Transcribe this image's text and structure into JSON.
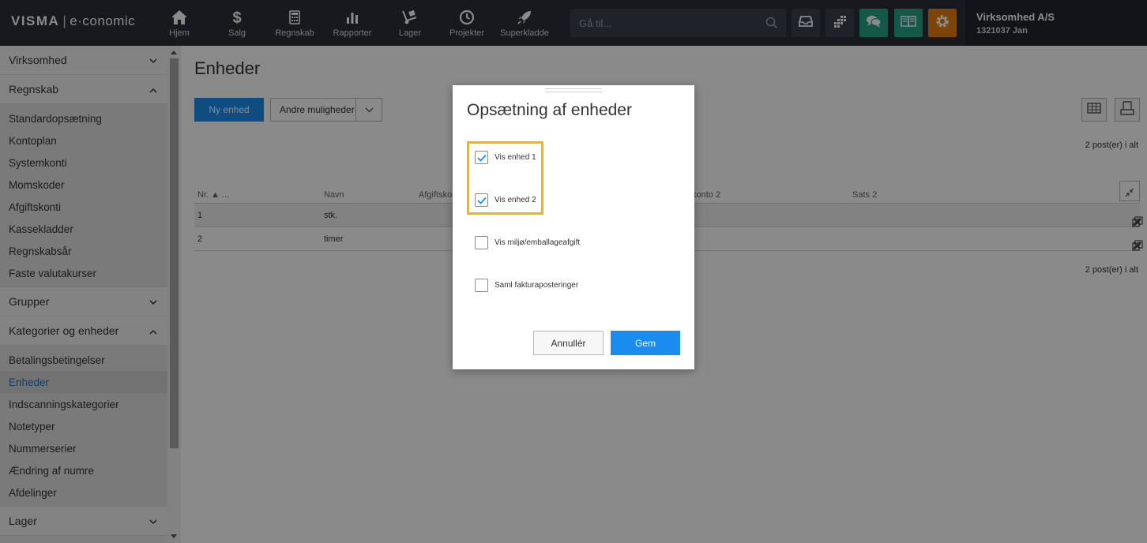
{
  "topbar": {
    "logo": {
      "brand": "VISMA",
      "sep": "|",
      "product": "e·conomic"
    },
    "nav": [
      {
        "label": "Hjem",
        "icon": "home-icon"
      },
      {
        "label": "Salg",
        "icon": "dollar-icon"
      },
      {
        "label": "Regnskab",
        "icon": "calculator-icon"
      },
      {
        "label": "Rapporter",
        "icon": "bar-chart-icon"
      },
      {
        "label": "Lager",
        "icon": "dolly-icon"
      },
      {
        "label": "Projekter",
        "icon": "clock-icon"
      },
      {
        "label": "Superkladde",
        "icon": "rocket-icon"
      }
    ],
    "search": {
      "placeholder": "Gå til..."
    },
    "tools": [
      {
        "icon": "inbox-icon",
        "color": "#3b404c"
      },
      {
        "icon": "apps-icon",
        "color": "#3b404c"
      },
      {
        "icon": "chat-icon",
        "color": "#23a48a"
      },
      {
        "icon": "book-icon",
        "color": "#23a48a"
      },
      {
        "icon": "gear-icon",
        "color": "#e67e10"
      }
    ],
    "company": {
      "name": "Virksomhed A/S",
      "user": "1321037 Jan"
    }
  },
  "sidebar": {
    "groups": [
      {
        "label": "Virksomhed",
        "expanded": false
      },
      {
        "label": "Regnskab",
        "expanded": true
      },
      {
        "label": "Grupper",
        "expanded": false
      },
      {
        "label": "Kategorier og enheder",
        "expanded": true
      },
      {
        "label": "Lager",
        "expanded": false
      }
    ],
    "regnskab_items": [
      "Standardopsætning",
      "Kontoplan",
      "Systemkonti",
      "Momskoder",
      "Afgiftskonti",
      "Kassekladder",
      "Regnskabsår",
      "Faste valutakurser"
    ],
    "kategorier_items": [
      "Betalingsbetingelser",
      "Enheder",
      "Indscanningskategorier",
      "Notetyper",
      "Nummerserier",
      "Ændring af numre",
      "Afdelinger"
    ],
    "active_item": "Enheder"
  },
  "main": {
    "title": "Enheder",
    "new_button": "Ny enhed",
    "more_button": "Andre muligheder",
    "post_count": "2 post(er) i alt",
    "table": {
      "headers": {
        "nr": "Nr. ▲ ...",
        "navn": "Navn",
        "afgift": "Afgiftsko",
        "konto2": "konto 2",
        "sats2": "Sats 2"
      },
      "rows": [
        {
          "nr": "1",
          "navn": "stk."
        },
        {
          "nr": "2",
          "navn": "timer"
        }
      ]
    }
  },
  "modal": {
    "title": "Opsætning af enheder",
    "options": [
      {
        "label": "Vis enhed 1",
        "checked": true
      },
      {
        "label": "Vis enhed 2",
        "checked": true
      },
      {
        "label": "Vis miljø/emballageafgift",
        "checked": false
      },
      {
        "label": "Saml fakturaposteringer",
        "checked": false
      }
    ],
    "cancel_label": "Annullér",
    "save_label": "Gem"
  },
  "colors": {
    "topbar": "#2b2f3a",
    "primary": "#1a8cf0",
    "highlight": "#f2b705",
    "check": "#1a8cf0"
  }
}
